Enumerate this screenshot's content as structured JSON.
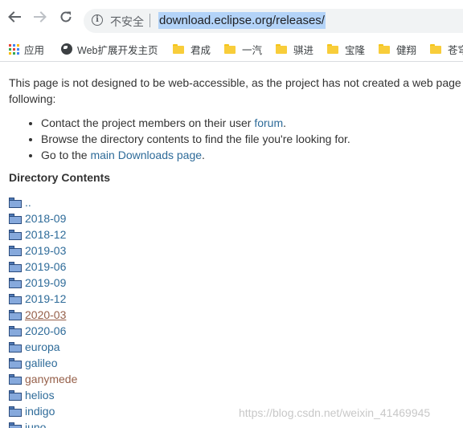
{
  "browser": {
    "security_label": "不安全",
    "url": "download.eclipse.org/releases/"
  },
  "bookmarks": [
    {
      "label": "应用",
      "icon": "apps-grid-icon"
    },
    {
      "label": "Web扩展开发主页",
      "icon": "globe-icon"
    },
    {
      "label": "君成",
      "icon": "folder-icon"
    },
    {
      "label": "一汽",
      "icon": "folder-icon"
    },
    {
      "label": "骐进",
      "icon": "folder-icon"
    },
    {
      "label": "宝隆",
      "icon": "folder-icon"
    },
    {
      "label": "健翔",
      "icon": "folder-icon"
    },
    {
      "label": "苍穹",
      "icon": "folder-icon"
    }
  ],
  "page": {
    "intro_line1": "This page is not designed to be web-accessible, as the project has not created a web page",
    "intro_line2": "following:",
    "bullet1_text": "Contact the project members on their user ",
    "bullet1_link": "forum",
    "bullet1_end": ".",
    "bullet2_text": "Browse the directory contents to find the file you're looking for.",
    "bullet3_text": "Go to the ",
    "bullet3_link": "main Downloads page",
    "bullet3_end": ".",
    "directory_title": "Directory Contents",
    "entries": [
      {
        "name": "..",
        "state": "normal"
      },
      {
        "name": "2018-09",
        "state": "normal"
      },
      {
        "name": "2018-12",
        "state": "normal"
      },
      {
        "name": "2019-03",
        "state": "normal"
      },
      {
        "name": "2019-06",
        "state": "normal"
      },
      {
        "name": "2019-09",
        "state": "normal"
      },
      {
        "name": "2019-12",
        "state": "normal"
      },
      {
        "name": "2020-03",
        "state": "visited-hover"
      },
      {
        "name": "2020-06",
        "state": "normal"
      },
      {
        "name": "europa",
        "state": "normal"
      },
      {
        "name": "galileo",
        "state": "normal"
      },
      {
        "name": "ganymede",
        "state": "visited"
      },
      {
        "name": "helios",
        "state": "normal"
      },
      {
        "name": "indigo",
        "state": "normal"
      },
      {
        "name": "juno",
        "state": "normal"
      }
    ]
  },
  "watermark": "https://blog.csdn.net/weixin_41469945"
}
